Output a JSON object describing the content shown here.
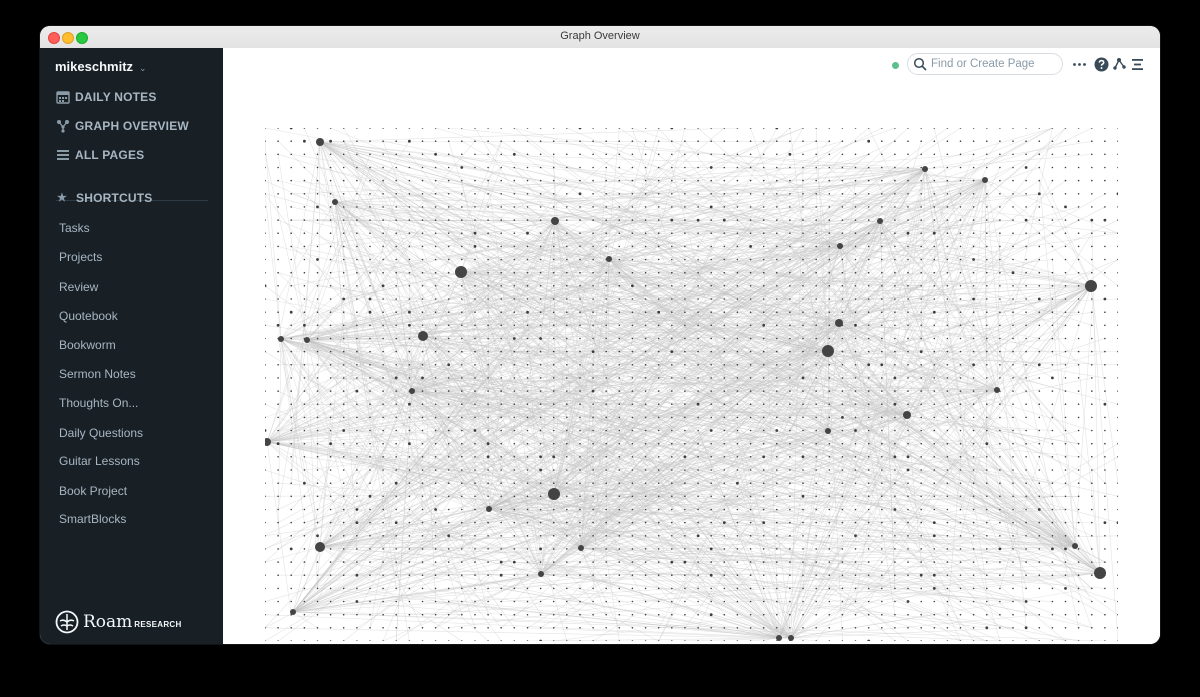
{
  "window": {
    "title": "Graph Overview"
  },
  "sidebar": {
    "graph_name": "mikeschmitz",
    "nav": [
      {
        "label": "DAILY NOTES",
        "icon": "calendar-icon"
      },
      {
        "label": "GRAPH OVERVIEW",
        "icon": "graph-icon"
      },
      {
        "label": "ALL PAGES",
        "icon": "list-icon"
      }
    ],
    "shortcuts_heading": "SHORTCUTS",
    "shortcuts": [
      "Tasks",
      "Projects",
      "Review",
      "Quotebook",
      "Bookworm",
      "Sermon Notes",
      "Thoughts On...",
      "Daily Questions",
      "Guitar Lessons",
      "Book Project",
      "SmartBlocks"
    ],
    "brand": {
      "name": "Roam",
      "sub": "RESEARCH"
    }
  },
  "topbar": {
    "search_placeholder": "Find or Create Page",
    "sync_color": "#5bbf8e"
  },
  "colors": {
    "sidebar_bg": "#182026",
    "sidebar_text": "#a7b6c2",
    "node": "#3d3d3d",
    "edge": "#c4c4c4"
  }
}
